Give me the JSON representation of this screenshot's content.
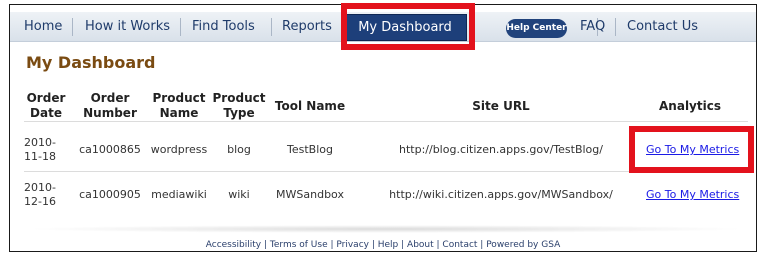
{
  "nav": {
    "items": [
      {
        "label": "Home"
      },
      {
        "label": "How it Works"
      },
      {
        "label": "Find Tools"
      },
      {
        "label": "Reports"
      }
    ],
    "active_tab": "My Dashboard",
    "help_center": "Help Center",
    "right_items": [
      {
        "label": "FAQ"
      },
      {
        "label": "Contact Us"
      }
    ]
  },
  "page": {
    "title": "My Dashboard"
  },
  "table": {
    "headers": {
      "order_date": [
        "Order",
        "Date"
      ],
      "order_number": [
        "Order",
        "Number"
      ],
      "product_name": [
        "Product",
        "Name"
      ],
      "product_type": [
        "Product",
        "Type"
      ],
      "tool_name": "Tool Name",
      "site_url": "Site URL",
      "analytics": "Analytics"
    },
    "rows": [
      {
        "order_date": [
          "2010-",
          "11-18"
        ],
        "order_number": "ca1000865",
        "product_name": "wordpress",
        "product_type": "blog",
        "tool_name": "TestBlog",
        "site_url": "http://blog.citizen.apps.gov/TestBlog/",
        "analytics": "Go To My Metrics"
      },
      {
        "order_date": [
          "2010-",
          "12-16"
        ],
        "order_number": "ca1000905",
        "product_name": "mediawiki",
        "product_type": "wiki",
        "tool_name": "MWSandbox",
        "site_url": "http://wiki.citizen.apps.gov/MWSandbox/",
        "analytics": "Go To My Metrics"
      }
    ]
  },
  "footer": {
    "links": [
      "Accessibility",
      "Terms of Use",
      "Privacy",
      "Help",
      "About",
      "Contact",
      "Powered by GSA"
    ],
    "separator": " | "
  },
  "colors": {
    "nav_active": "#1d3f7a",
    "highlight": "#e3121c",
    "title": "#7a4b12",
    "link": "#1a1ae6"
  }
}
